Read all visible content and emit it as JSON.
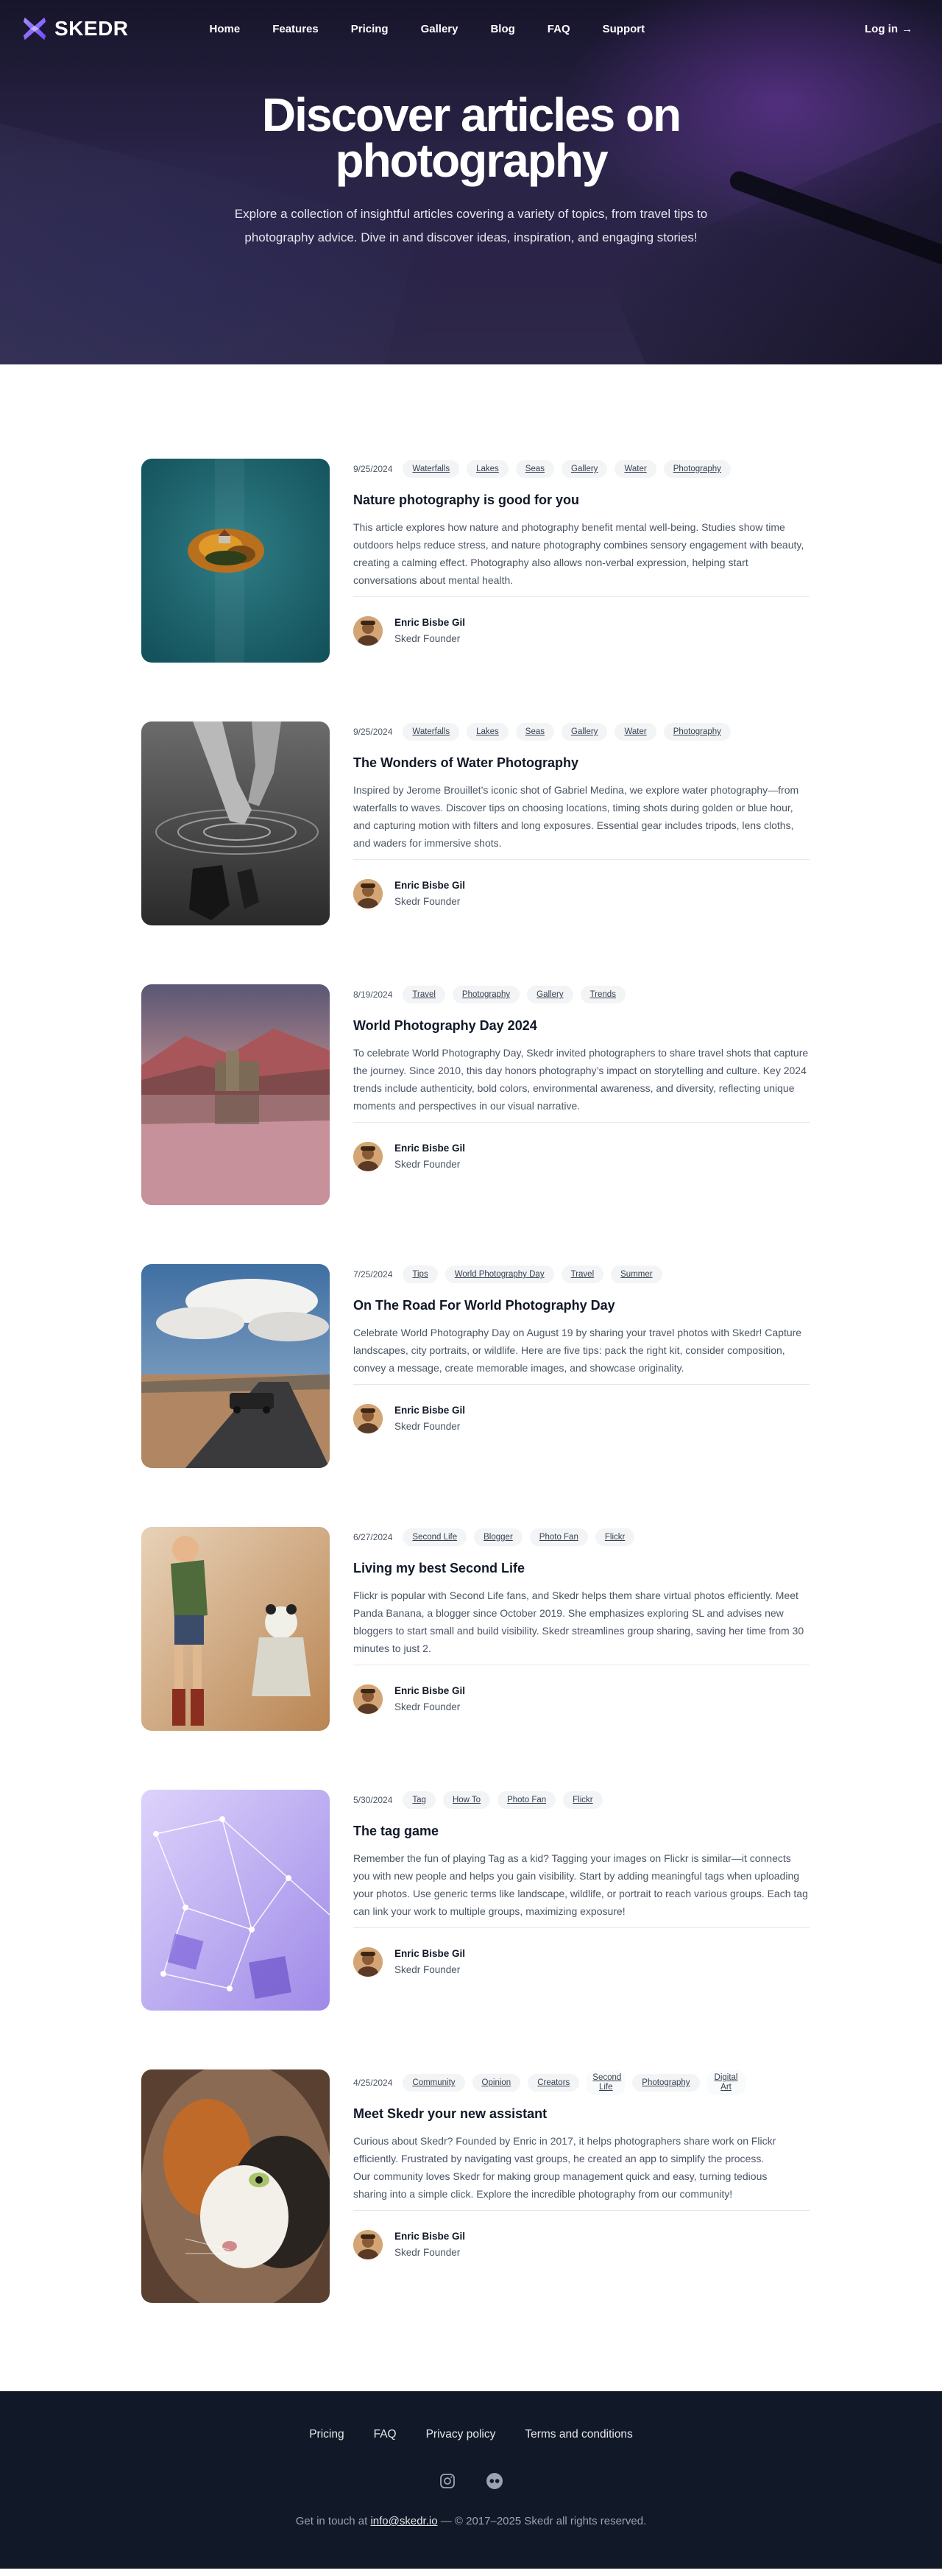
{
  "nav": {
    "logo_text": "SKEDR",
    "links": [
      "Home",
      "Features",
      "Pricing",
      "Gallery",
      "Blog",
      "FAQ",
      "Support"
    ],
    "login": "Log in",
    "login_arrow": "→"
  },
  "hero": {
    "title": "Discover articles on photography",
    "subtitle": "Explore a collection of insightful articles covering a variety of topics, from travel tips to photography advice. Dive in and discover ideas, inspiration, and engaging stories!"
  },
  "articles": [
    {
      "date": "9/25/2024",
      "tags": [
        "Waterfalls",
        "Lakes",
        "Seas",
        "Gallery",
        "Water",
        "Photography"
      ],
      "title": "Nature photography is good for you",
      "description": "This article explores how nature and photography benefit mental well-being. Studies show time outdoors helps reduce stress, and nature photography combines sensory engagement with beauty, creating a calming effect. Photography also allows non-verbal expression, helping start conversations about mental health.",
      "author": "Enric Bisbe Gil",
      "role": "Skedr Founder",
      "image": "aerial-island-lake"
    },
    {
      "date": "9/25/2024",
      "tags": [
        "Waterfalls",
        "Lakes",
        "Seas",
        "Gallery",
        "Water",
        "Photography"
      ],
      "title": "The Wonders of Water Photography",
      "description": "Inspired by Jerome Brouillet’s iconic shot of Gabriel Medina, we explore water photography—from waterfalls to waves. Discover tips on choosing locations, timing shots during golden or blue hour, and capturing motion with filters and long exposures. Essential gear includes tripods, lens cloths, and waders for immersive shots.",
      "author": "Enric Bisbe Gil",
      "role": "Skedr Founder",
      "image": "hand-water-bw"
    },
    {
      "date": "8/19/2024",
      "tags": [
        "Travel",
        "Photography",
        "Gallery",
        "Trends"
      ],
      "title": "World Photography Day 2024",
      "description": "To celebrate World Photography Day, Skedr invited photographers to share travel shots that capture the journey. Since 2010, this day honors photography’s impact on storytelling and culture. Key 2024 trends include authenticity, bold colors, environmental awareness, and diversity, reflecting unique moments and perspectives in our visual narrative.",
      "author": "Enric Bisbe Gil",
      "role": "Skedr Founder",
      "image": "castle-lake"
    },
    {
      "date": "7/25/2024",
      "tags": [
        "Tips",
        "World Photography Day",
        "Travel",
        "Summer"
      ],
      "title": "On The Road For World Photography Day",
      "description": "Celebrate World Photography Day on August 19 by sharing your travel photos with Skedr! Capture landscapes, city portraits, or wildlife. Here are five tips: pack the right kit, consider composition, convey a message, create memorable images, and showcase originality.",
      "author": "Enric Bisbe Gil",
      "role": "Skedr Founder",
      "image": "road-car"
    },
    {
      "date": "6/27/2024",
      "tags": [
        "Second Life",
        "Blogger",
        "Photo Fan",
        "Flickr"
      ],
      "title": "Living my best Second Life",
      "description": "Flickr is popular with Second Life fans, and Skedr helps them share virtual photos efficiently. Meet Panda Banana, a blogger since October 2019. She emphasizes exploring SL and advises new bloggers to start small and build visibility. Skedr streamlines group sharing, saving her time from 30 minutes to just 2.",
      "author": "Enric Bisbe Gil",
      "role": "Skedr Founder",
      "image": "second-life-girls"
    },
    {
      "date": "5/30/2024",
      "tags": [
        "Tag",
        "How To",
        "Photo Fan",
        "Flickr"
      ],
      "title": "The tag game",
      "description": "Remember the fun of playing Tag as a kid? Tagging your images on Flickr is similar—it connects you with new people and helps you gain visibility. Start by adding meaningful tags when uploading your photos. Use generic terms like landscape, wildlife, or portrait to reach various groups. Each tag can link your work to multiple groups, maximizing exposure!",
      "author": "Enric Bisbe Gil",
      "role": "Skedr Founder",
      "image": "purple-network"
    },
    {
      "date": "4/25/2024",
      "tags": [
        "Community",
        "Opinion",
        "Creators",
        "Second Life",
        "Photography",
        "Digital Art"
      ],
      "title": "Meet Skedr your new assistant",
      "description": "Curious about Skedr? Founded by Enric in 2017, it helps photographers share work on Flickr efficiently. Frustrated by navigating vast groups, he created an app to simplify the process. Our community loves Skedr for making group management quick and easy, turning tedious sharing into a simple click. Explore the incredible photography from our community!",
      "author": "Enric Bisbe Gil",
      "role": "Skedr Founder",
      "image": "cat-closeup"
    }
  ],
  "footer": {
    "links": [
      "Pricing",
      "FAQ",
      "Privacy policy",
      "Terms and conditions"
    ],
    "icons": [
      "instagram-icon",
      "flickr-icon"
    ],
    "contact_prefix": "Get in touch at",
    "email": "info@skedr.io",
    "copyright": "— © 2017–2025 Skedr all rights reserved."
  },
  "colors": {
    "brand_purple": "#7c5cff",
    "footer_bg": "#111827",
    "tag_bg": "#f3f4f6"
  }
}
